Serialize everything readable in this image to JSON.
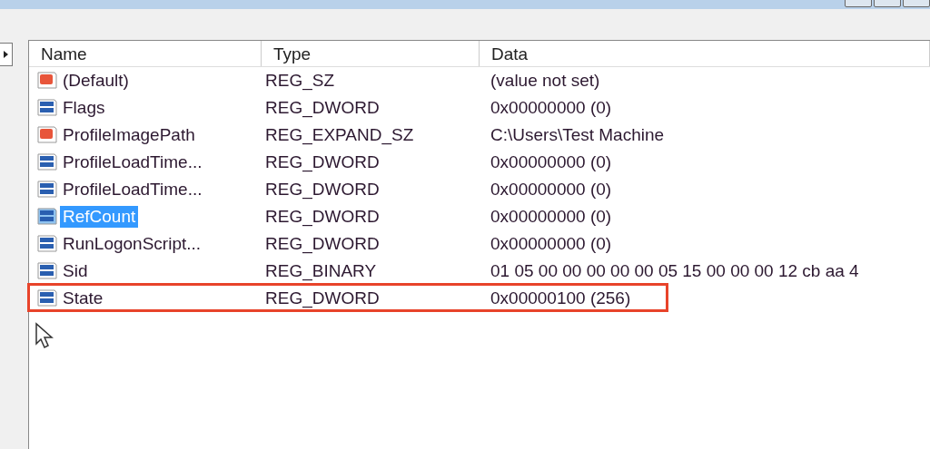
{
  "table": {
    "columns": [
      "Name",
      "Type",
      "Data"
    ],
    "rows": [
      {
        "kind": "string",
        "name": "(Default)",
        "type": "REG_SZ",
        "data": "(value not set)",
        "selected": false,
        "highlighted": false
      },
      {
        "kind": "binary",
        "name": "Flags",
        "type": "REG_DWORD",
        "data": "0x00000000 (0)",
        "selected": false,
        "highlighted": false
      },
      {
        "kind": "string",
        "name": "ProfileImagePath",
        "type": "REG_EXPAND_SZ",
        "data": "C:\\Users\\Test Machine",
        "selected": false,
        "highlighted": false
      },
      {
        "kind": "binary",
        "name": "ProfileLoadTime...",
        "type": "REG_DWORD",
        "data": "0x00000000 (0)",
        "selected": false,
        "highlighted": false
      },
      {
        "kind": "binary",
        "name": "ProfileLoadTime...",
        "type": "REG_DWORD",
        "data": "0x00000000 (0)",
        "selected": false,
        "highlighted": false
      },
      {
        "kind": "binary",
        "name": "RefCount",
        "type": "REG_DWORD",
        "data": "0x00000000 (0)",
        "selected": true,
        "highlighted": false
      },
      {
        "kind": "binary",
        "name": "RunLogonScript...",
        "type": "REG_DWORD",
        "data": "0x00000000 (0)",
        "selected": false,
        "highlighted": false
      },
      {
        "kind": "binary",
        "name": "Sid",
        "type": "REG_BINARY",
        "data": "01 05 00 00 00 00 00 05 15 00 00 00 12 cb aa 4",
        "selected": false,
        "highlighted": false
      },
      {
        "kind": "binary",
        "name": "State",
        "type": "REG_DWORD",
        "data": "0x00000100 (256)",
        "selected": false,
        "highlighted": true
      }
    ]
  }
}
